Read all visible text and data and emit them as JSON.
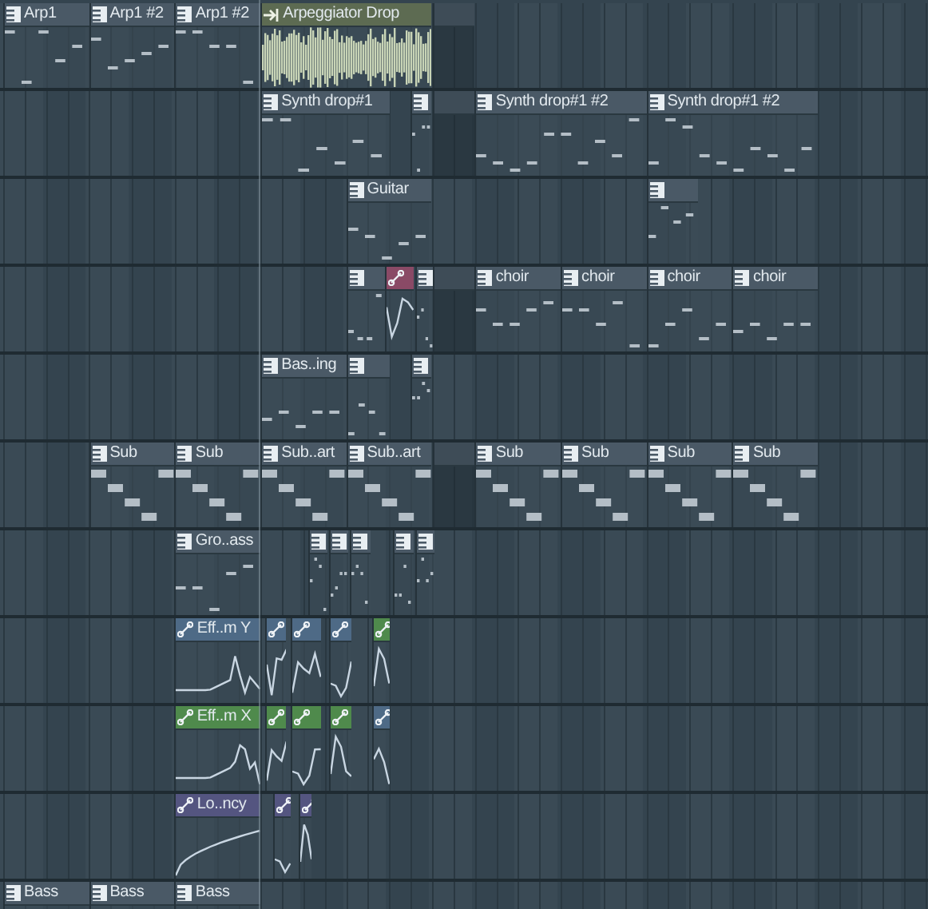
{
  "tracks": [
    {
      "clips": [
        {
          "kind": "pattern",
          "label": "Arp1"
        },
        {
          "kind": "pattern",
          "label": "Arp1 #2"
        },
        {
          "kind": "pattern",
          "label": "Arp1 #2"
        },
        {
          "kind": "audio",
          "label": "Arpeggiator Drop"
        },
        {
          "kind": "blank"
        }
      ]
    },
    {
      "clips": [
        {
          "kind": "pattern",
          "label": "Synth drop#1"
        },
        {
          "kind": "pattern"
        },
        {
          "kind": "blank"
        },
        {
          "kind": "pattern",
          "label": "Synth drop#1 #2"
        },
        {
          "kind": "pattern",
          "label": "Synth drop#1 #2"
        }
      ]
    },
    {
      "clips": [
        {
          "kind": "pattern",
          "label": "Guitar"
        },
        {
          "kind": "pattern"
        }
      ]
    },
    {
      "clips": [
        {
          "kind": "pattern"
        },
        {
          "kind": "automation",
          "color": "#8a4a66"
        },
        {
          "kind": "pattern"
        },
        {
          "kind": "blank"
        },
        {
          "kind": "pattern",
          "label": "choir"
        },
        {
          "kind": "pattern",
          "label": "choir"
        },
        {
          "kind": "pattern",
          "label": "choir"
        },
        {
          "kind": "pattern",
          "label": "choir"
        }
      ]
    },
    {
      "clips": [
        {
          "kind": "pattern",
          "label": "Bas..ing"
        },
        {
          "kind": "pattern"
        },
        {
          "kind": "pattern"
        }
      ]
    },
    {
      "clips": [
        {
          "kind": "pattern",
          "label": "Sub"
        },
        {
          "kind": "pattern",
          "label": "Sub"
        },
        {
          "kind": "pattern",
          "label": "Sub..art"
        },
        {
          "kind": "pattern",
          "label": "Sub..art"
        },
        {
          "kind": "blank"
        },
        {
          "kind": "pattern",
          "label": "Sub"
        },
        {
          "kind": "pattern",
          "label": "Sub"
        },
        {
          "kind": "pattern",
          "label": "Sub"
        },
        {
          "kind": "pattern",
          "label": "Sub"
        }
      ]
    },
    {
      "clips": [
        {
          "kind": "pattern",
          "label": "Gro..ass"
        },
        {
          "kind": "pattern"
        },
        {
          "kind": "pattern"
        },
        {
          "kind": "pattern"
        },
        {
          "kind": "pattern"
        },
        {
          "kind": "pattern"
        }
      ]
    },
    {
      "clips": [
        {
          "kind": "automation",
          "label": "Eff..m Y",
          "color": "#4e6a86"
        },
        {
          "kind": "automation",
          "color": "#4e6a86"
        },
        {
          "kind": "automation",
          "color": "#4e6a86"
        },
        {
          "kind": "automation",
          "color": "#4e6a86"
        },
        {
          "kind": "automation",
          "color": "#4f8a4c"
        }
      ]
    },
    {
      "clips": [
        {
          "kind": "automation",
          "label": "Eff..m X",
          "color": "#4f8a4c"
        },
        {
          "kind": "automation",
          "color": "#4f8a4c"
        },
        {
          "kind": "automation",
          "color": "#4f8a4c"
        },
        {
          "kind": "automation",
          "color": "#4f8a4c"
        },
        {
          "kind": "automation",
          "color": "#4e6a86"
        }
      ]
    },
    {
      "clips": [
        {
          "kind": "automation",
          "label": "Lo..ncy",
          "color": "#545580"
        },
        {
          "kind": "automation",
          "color": "#545580"
        },
        {
          "kind": "automation",
          "color": "#545580"
        }
      ]
    },
    {
      "clips": [
        {
          "kind": "pattern",
          "label": "Bass"
        },
        {
          "kind": "pattern",
          "label": "Bass"
        },
        {
          "kind": "pattern",
          "label": "Bass"
        }
      ]
    }
  ]
}
